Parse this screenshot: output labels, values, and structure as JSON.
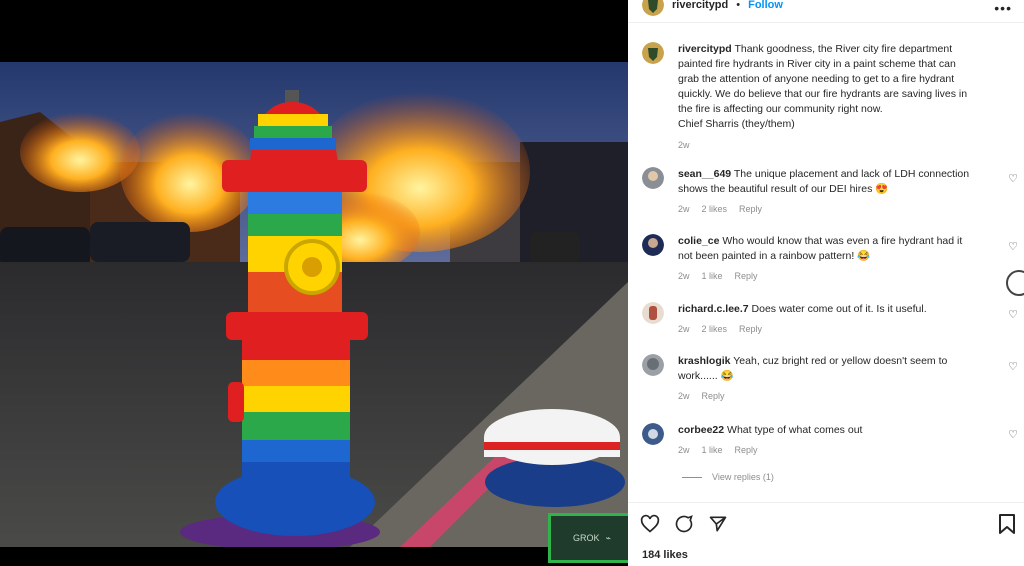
{
  "post": {
    "username": "rivercitypd",
    "follow_label": "Follow",
    "more_label": "•••",
    "caption": "Thank goodness, the River city fire department painted fire hydrants in River city in a paint scheme that can grab the attention of anyone needing to get to a fire hydrant quickly. We do believe that our fire hydrants are saving lives in the fire is affecting our community right now.",
    "signature": "Chief Sharris (they/them)",
    "time": "2w",
    "likes": "184 likes"
  },
  "media": {
    "watermark": "GROK"
  },
  "comments": [
    {
      "user": "sean__649",
      "text": "The unique placement and lack of LDH connection shows the beautiful result of our DEI hires",
      "emoji": "😍",
      "time": "2w",
      "likes": "2 likes",
      "reply": "Reply"
    },
    {
      "user": "colie_ce",
      "text": "Who would know that was even a fire hydrant had it not been painted in a rainbow pattern!",
      "emoji": "😂",
      "time": "2w",
      "likes": "1 like",
      "reply": "Reply"
    },
    {
      "user": "richard.c.lee.7",
      "text": "Does water come out of it. Is it useful.",
      "emoji": "",
      "time": "2w",
      "likes": "2 likes",
      "reply": "Reply"
    },
    {
      "user": "krashlogik",
      "text": "Yeah, cuz bright red or yellow doesn't seem to work......",
      "emoji": "😂",
      "time": "2w",
      "likes": "",
      "reply": "Reply"
    },
    {
      "user": "corbee22",
      "text": "What type of what comes out",
      "emoji": "",
      "time": "2w",
      "likes": "1 like",
      "reply": "Reply"
    }
  ],
  "view_replies": "View replies (1)",
  "icons": [
    "heart-icon",
    "comment-icon",
    "share-icon",
    "bookmark-icon",
    "more-icon"
  ]
}
